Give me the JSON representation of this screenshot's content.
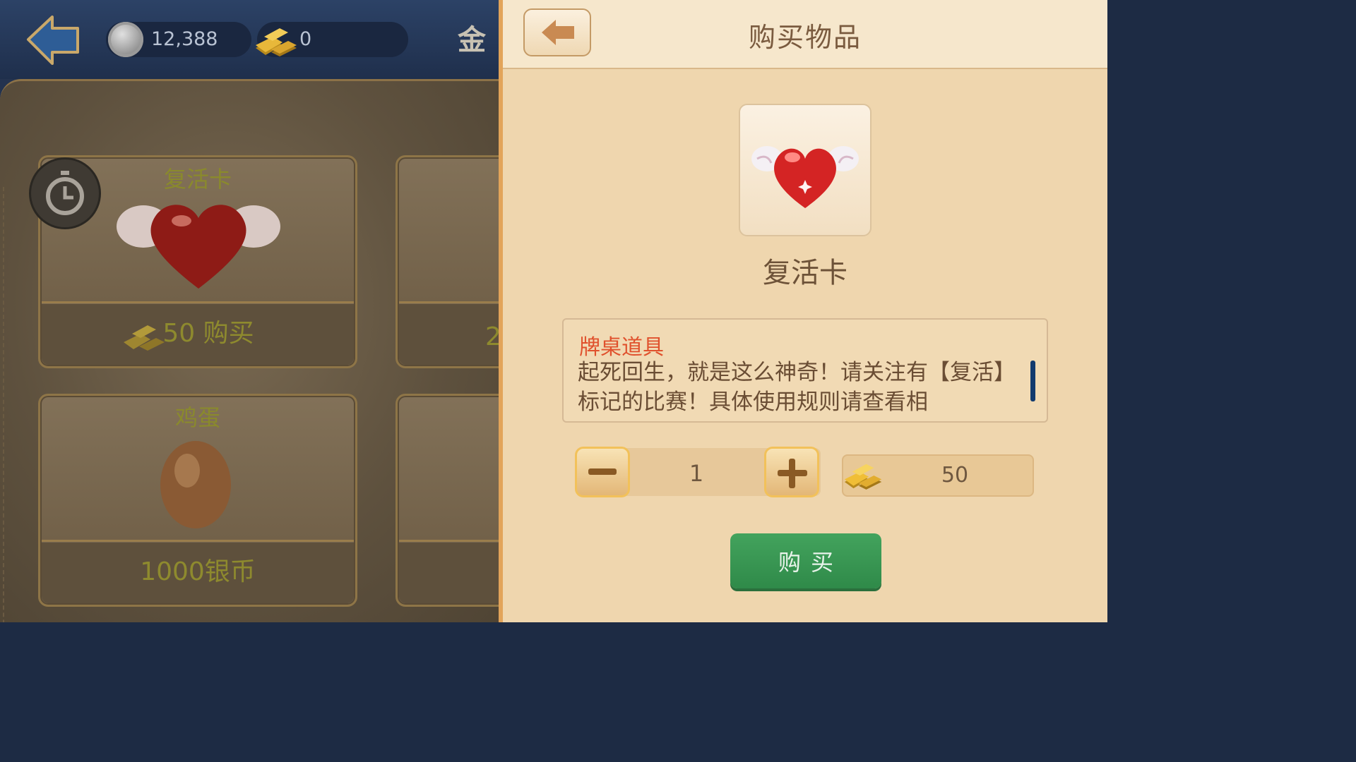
{
  "left": {
    "silver": "12,388",
    "gold": "0",
    "gold_tab": "金",
    "cards": [
      {
        "title": "复活卡",
        "price": "50 购买"
      },
      {
        "title": "鸡蛋",
        "price": "1000银币"
      }
    ],
    "partial_price": "2"
  },
  "dialog": {
    "title": "购买物品",
    "item_name": "复活卡",
    "category": "牌桌道具",
    "description": "起死回生，就是这么神奇！请关注有【复活】标记的比赛！具体使用规则请查看相",
    "quantity": "1",
    "cost": "50",
    "buy_label": "购买"
  },
  "colors": {
    "accent_green": "#3a9a55",
    "dialog_bg": "#efd6ae",
    "category_red": "#e0512d"
  }
}
